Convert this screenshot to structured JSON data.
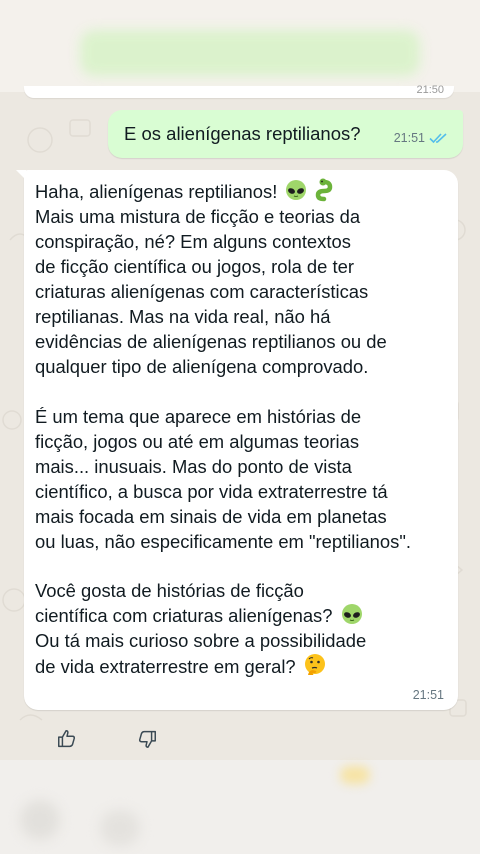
{
  "outgoing": {
    "text": "E os alienígenas reptilianos?",
    "time": "21:51",
    "status": "read"
  },
  "incoming": {
    "para1": [
      "Haha, alienígenas reptilianos!",
      "Mais uma mistura de ficção e teorias da",
      "conspiração, né? Em alguns contextos",
      "de ficção científica ou jogos, rola de ter",
      "criaturas alienígenas com características",
      "reptilianas. Mas na vida real, não há",
      "evidências de alienígenas reptilianos ou de",
      "qualquer tipo de alienígena comprovado."
    ],
    "para2": [
      "É um tema que aparece em histórias de",
      "ficção, jogos ou até em algumas teorias",
      "mais... inusuais. Mas do ponto de vista",
      "científico, a busca por vida extraterrestre tá",
      "mais focada em sinais de vida em planetas",
      "ou luas, não especificamente em \"reptilianos\"."
    ],
    "para3": [
      "Você gosta de histórias de ficção",
      "científica com criaturas alienígenas?",
      "Ou tá mais curioso sobre a possibilidade",
      "de vida extraterrestre em geral?"
    ],
    "time": "21:51"
  },
  "icons": [
    "alien-emoji-icon",
    "snake-emoji-icon",
    "thinking-emoji-icon",
    "double-check-icon",
    "thumbs-up-icon",
    "thumbs-down-icon"
  ],
  "colors": {
    "outgoing_bubble": "#d9fdd3",
    "incoming_bubble": "#ffffff",
    "chat_background": "#ece8e1",
    "read_ticks": "#53bdeb"
  }
}
